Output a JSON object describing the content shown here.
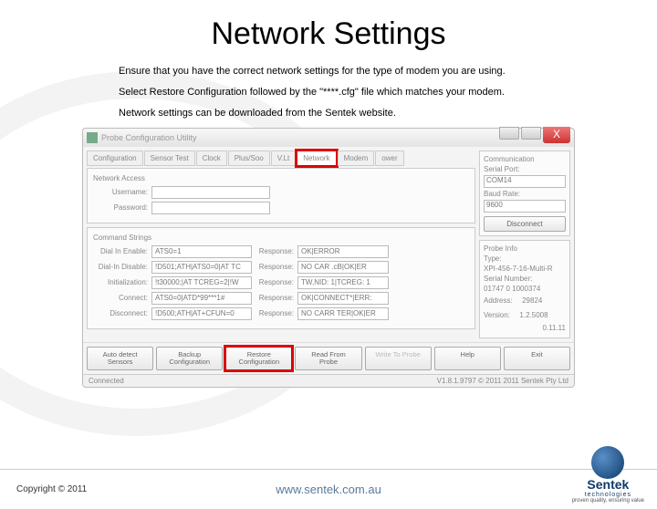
{
  "slide": {
    "title": "Network Settings",
    "desc1": "Ensure that you have the correct network settings for the type of modem you are using.",
    "desc2": "Select Restore Configuration followed by the \"****.cfg\" file which matches your modem.",
    "desc3": "Network settings can be downloaded from the Sentek website."
  },
  "titlebar": {
    "text": "Probe Configuration Utility"
  },
  "tabs": [
    "Configuration",
    "Sensor Test",
    "Clock",
    "Plus/Soo",
    "V.Lt",
    "Network",
    "Modem",
    "ower"
  ],
  "network_access": {
    "label": "Network Access",
    "username_lbl": "Username:",
    "password_lbl": "Password:",
    "username": "",
    "password": ""
  },
  "command_strings": {
    "label": "Command Strings",
    "rows": [
      {
        "lbl": "Dial In Enable:",
        "val": "ATS0=1",
        "resp": "OK|ERROR"
      },
      {
        "lbl": "Dial-In Disable:",
        "val": "!D501;ATH|ATS0=0|AT TC",
        "resp": "NO CAR .cB|OK|ER"
      },
      {
        "lbl": "Initialization:",
        "val": "!t30000;|AT TCREG=2|!W",
        "resp": "TW,NID: 1|TCREG: 1"
      },
      {
        "lbl": "Connect:",
        "val": "ATS0=0|ATD*99***1#",
        "resp": "OK|CONNECT*|ERR:"
      },
      {
        "lbl": "Disconnect:",
        "val": "!D500;ATH|AT+CFUN=0",
        "resp": "NO CARR TER|OK|ER"
      }
    ],
    "response_lbl": "Response:"
  },
  "comm": {
    "label": "Communication",
    "serial_lbl": "Serial Port:",
    "serial": "COM14",
    "baud_lbl": "Baud Rate:",
    "baud": "9600",
    "disconnect": "Disconnect"
  },
  "probe": {
    "label": "Probe Info",
    "type_lbl": "Type:",
    "type": "XPI-456-7-16-Multi-R",
    "serial_lbl": "Serial Number:",
    "serial": "01747 0 1000374",
    "addr_lbl": "Address:",
    "addr": "29824",
    "ver_lbl": "Version:",
    "ver": "1.2.5008",
    "ver2": "0.11.11"
  },
  "buttons": {
    "auto": "Auto detect\nSensors",
    "backup": "Backup\nConfiguration",
    "restore": "Restore\nConfiguration",
    "read": "Read From\nProbe",
    "write": "Write To Probe",
    "help": "Help",
    "exit": "Exit"
  },
  "status": {
    "left": "Connected",
    "right": "V1.8.1.9797 © 2011 2011 Sentek Pty Ltd"
  },
  "footer": {
    "copyright": "Copyright © 2011",
    "url": "www.sentek.com.au",
    "logo": "Sentek",
    "logo_sub": "technologies",
    "logo_tag": "proven quality, ensuring value"
  }
}
